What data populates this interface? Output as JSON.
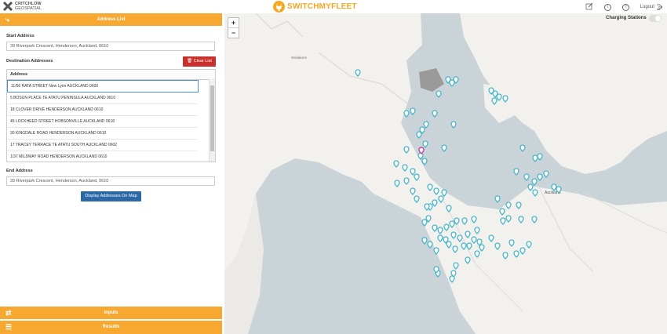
{
  "header": {
    "left_logo_line1": "CRITCHLOW",
    "left_logo_line2": "GEOSPATIAL",
    "brand": "SWITCHMYFLEET",
    "logout_label": "Logout",
    "icons": [
      "edit-icon",
      "info-icon",
      "help-icon",
      "logout-icon"
    ]
  },
  "panel": {
    "address_list_label": "Address List",
    "start_address_label": "Start Address",
    "start_address_value": "39 Riverpark Crescent, Henderson, Auckland, 0610",
    "destination_label": "Destination Addresses",
    "clear_list_label": "Clear List",
    "table_header": "Address",
    "addresses": [
      "11/56 RATA STREET New Lynn AUCKLAND 0600",
      "5 BOSUN PLACE TE ATATU PENINSULA AUCKLAND 0610",
      "18 CLOVER DRIVE HENDERSON AUCKLAND 0610",
      "45 LOCKHEED STREET HOBSONVILLE AUCKLAND 0618",
      "30 KINGDALE ROAD HENDERSON AUCKLAND 0610",
      "17 TRACEY TERRACE TE ATATU SOUTH AUCKLAND 0602",
      "1/37 MILDMAY ROAD HENDERSON AUCKLAND 0610"
    ],
    "end_address_label": "End Address",
    "end_address_value": "39 Riverpark Crescent, Henderson, Auckland, 0610",
    "display_button_label": "Display Addresses On Map",
    "inputs_label": "Inputs",
    "results_label": "Results"
  },
  "map": {
    "zoom_in": "+",
    "zoom_out": "−",
    "charging_label": "Charging Stations",
    "place_labels": [
      "Waitakere",
      "Auckland"
    ],
    "marker_color": "#45b6c9",
    "start_marker_color": "#d43c9c",
    "land_color": "#f2f1ee",
    "water_color": "#c9d3d8",
    "accent_color": "#f6a830"
  }
}
